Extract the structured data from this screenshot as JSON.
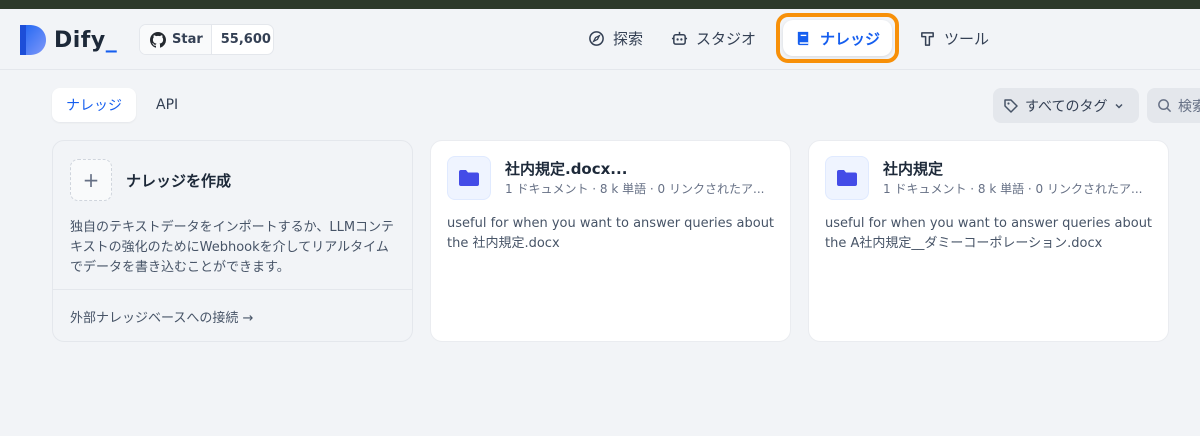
{
  "app": {
    "logo_text": "Dify",
    "logo_dot": "_",
    "star_label": "Star",
    "star_count": "55,600"
  },
  "nav": {
    "explore": "探索",
    "studio": "スタジオ",
    "knowledge": "ナレッジ",
    "tools": "ツール"
  },
  "tabs": {
    "knowledge": "ナレッジ",
    "api": "API"
  },
  "filters": {
    "tags_label": "すべてのタグ",
    "search_placeholder": "検索"
  },
  "create_card": {
    "title": "ナレッジを作成",
    "description": "独自のテキストデータをインポートするか、LLMコンテキストの強化のためにWebhookを介してリアルタイムでデータを書き込むことができます。",
    "external_link": "外部ナレッジベースへの接続 →"
  },
  "datasets": [
    {
      "title": "社内規定.docx...",
      "meta": "1 ドキュメント · 8 k 単語 · 0 リンクされたア...",
      "description": "useful for when you want to answer queries about the 社内規定.docx"
    },
    {
      "title": "社内規定",
      "meta": "1 ドキュメント · 8 k 単語 · 0 リンクされたア...",
      "description": "useful for when you want to answer queries about the A社内規定__ダミーコーポレーション.docx"
    }
  ],
  "colors": {
    "accent": "#155eef",
    "highlight": "#f79009",
    "folder": "#444ce7"
  },
  "icons": [
    "compass-icon",
    "robot-icon",
    "book-icon",
    "hammer-icon",
    "github-icon",
    "tag-icon",
    "chevron-down-icon",
    "search-icon",
    "folder-icon",
    "plus-icon"
  ]
}
